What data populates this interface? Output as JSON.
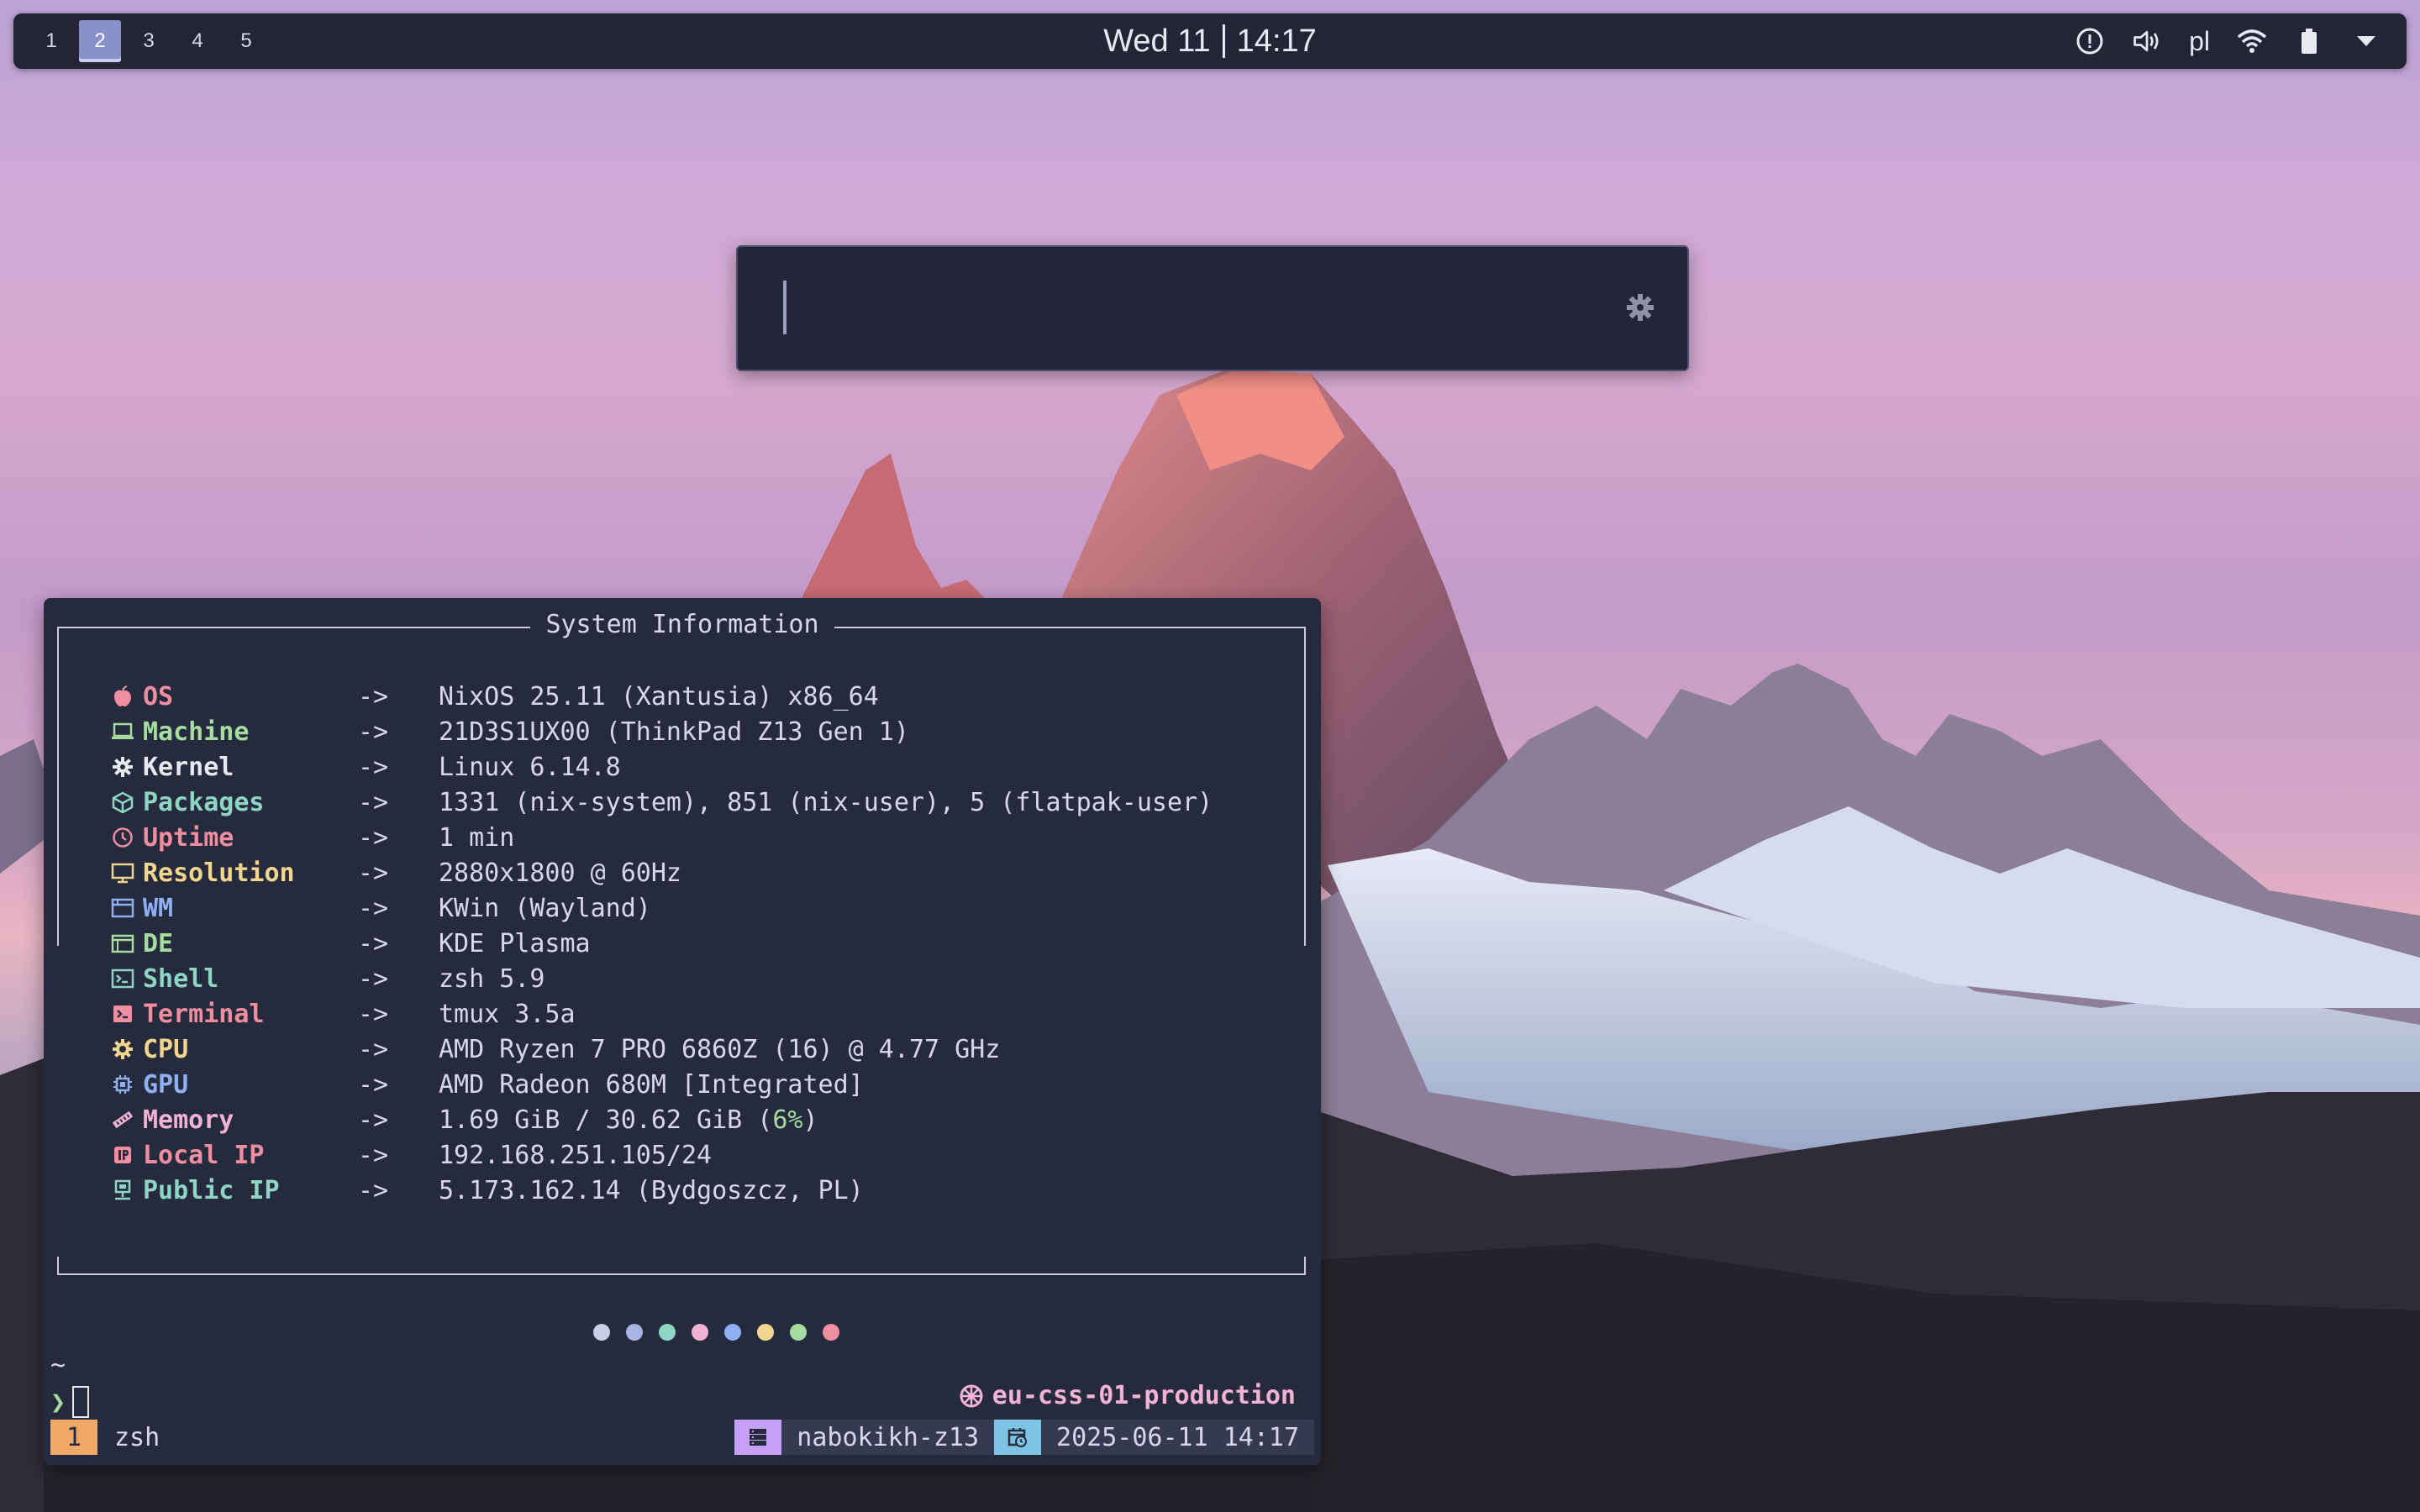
{
  "panel": {
    "workspaces": [
      "1",
      "2",
      "3",
      "4",
      "5"
    ],
    "active_workspace": "2",
    "clock_date": "Wed 11",
    "clock_time": "14:17",
    "tray": {
      "icons": [
        "info-icon",
        "volume-icon",
        "wifi-icon",
        "battery-icon",
        "expand-tray-icon"
      ],
      "language": "pl"
    }
  },
  "launcher": {
    "query": "",
    "icon": "gear-icon"
  },
  "terminal": {
    "box_title": "System Information",
    "arrow": "->",
    "rows": [
      {
        "icon": "apple-icon",
        "key": "OS",
        "value": "NixOS 25.11 (Xantusia) x86_64",
        "color": "#ee8ea0"
      },
      {
        "icon": "laptop-icon",
        "key": "Machine",
        "value": "21D3S1UX00 (ThinkPad Z13 Gen 1)",
        "color": "#a6dca0"
      },
      {
        "icon": "gear-icon",
        "key": "Kernel",
        "value": "Linux 6.14.8",
        "color": "#e8e8f0"
      },
      {
        "icon": "package-icon",
        "key": "Packages",
        "value": "1331 (nix-system), 851 (nix-user), 5 (flatpak-user)",
        "color": "#8fd5c4"
      },
      {
        "icon": "clock-icon",
        "key": "Uptime",
        "value": "1 min",
        "color": "#ee8ea0"
      },
      {
        "icon": "monitor-icon",
        "key": "Resolution",
        "value": "2880x1800 @ 60Hz",
        "color": "#f2d68f"
      },
      {
        "icon": "window-icon",
        "key": "WM",
        "value": "KWin (Wayland)",
        "color": "#8fb0f2"
      },
      {
        "icon": "desktop-window-icon",
        "key": "DE",
        "value": "KDE Plasma",
        "color": "#a6dca0"
      },
      {
        "icon": "shell-icon",
        "key": "Shell",
        "value": "zsh 5.9",
        "color": "#8fd5c4"
      },
      {
        "icon": "terminal-icon",
        "key": "Terminal",
        "value": "tmux 3.5a",
        "color": "#ee8ea0"
      },
      {
        "icon": "cpu-icon",
        "key": "CPU",
        "value": "AMD Ryzen 7 PRO 6860Z (16) @ 4.77 GHz",
        "color": "#f2d68f"
      },
      {
        "icon": "gpu-icon",
        "key": "GPU",
        "value": "AMD Radeon 680M [Integrated]",
        "color": "#8fb0f2"
      },
      {
        "icon": "memory-icon",
        "key": "Memory",
        "value_prefix": "1.69 GiB / 30.62 GiB (",
        "value_pct": "6%",
        "value_suffix": ")",
        "color": "#f2b2d6"
      },
      {
        "icon": "ip-icon",
        "key": "Local IP",
        "value": "192.168.251.105/24",
        "color": "#ee8ea0"
      },
      {
        "icon": "network-icon",
        "key": "Public IP",
        "value": "5.173.162.14 (Bydgoszcz, PL)",
        "color": "#8fd5c4"
      }
    ],
    "palette": [
      "#c9cde6",
      "#aab4e6",
      "#8fd5c4",
      "#f2b2d6",
      "#8fb0f2",
      "#f2d68f",
      "#a6dca0",
      "#ee8ea0"
    ],
    "prompt_dir": "~",
    "prompt_symbol": "❯",
    "kube_context": "eu-css-01-production",
    "status": {
      "window_index": "1",
      "window_name": "zsh",
      "host": "nabokikh-z13",
      "datetime": "2025-06-11 14:17"
    }
  }
}
